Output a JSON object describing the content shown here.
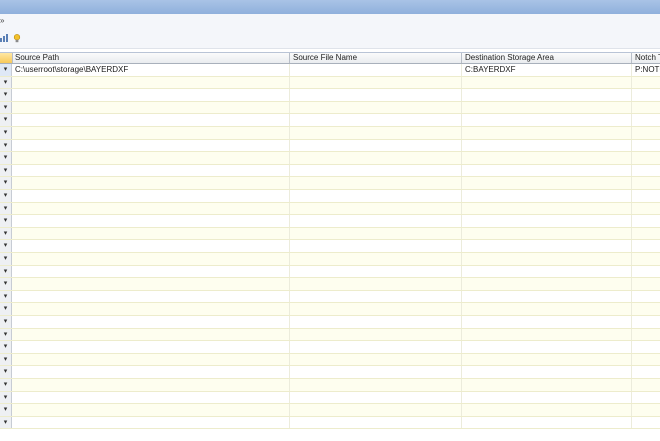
{
  "window": {},
  "menubar": {
    "glyph": "»"
  },
  "toolbar": {
    "icons": [
      "chart-icon",
      "lightbulb-icon"
    ]
  },
  "grid": {
    "columns": [
      {
        "key": "source_path",
        "label": "Source Path"
      },
      {
        "key": "source_file_name",
        "label": "Source File Name"
      },
      {
        "key": "destination_storage_area",
        "label": "Destination Storage Area"
      },
      {
        "key": "notch",
        "label": "Notch T"
      }
    ],
    "row_header_glyph": "▾",
    "rows": [
      {
        "source_path": "C:\\userroot\\storage\\BAYERDXF",
        "source_file_name": "",
        "destination_storage_area": "C:BAYERDXF",
        "notch": "P:NOTC"
      }
    ],
    "total_rows": 29,
    "colors": {
      "odd_row": "#fefeef",
      "even_row": "#ffffff",
      "header_corner": "#f8c95b"
    }
  }
}
